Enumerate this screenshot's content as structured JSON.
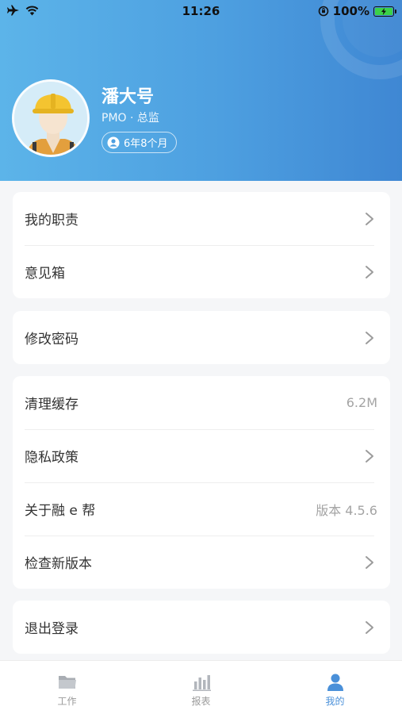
{
  "status_bar": {
    "time": "11:26",
    "battery_percent": "100%",
    "left_icons": [
      "airplane-icon",
      "wifi-icon"
    ],
    "right_icons": [
      "orientation-lock-icon",
      "battery-charging-icon"
    ]
  },
  "profile": {
    "name": "潘大号",
    "role": "PMO · 总监",
    "tenure": "6年8个月",
    "avatar": "worker-with-hard-hat"
  },
  "menu_groups": [
    [
      {
        "label": "我的职责",
        "value": "",
        "arrow": true
      },
      {
        "label": "意见箱",
        "value": "",
        "arrow": true
      }
    ],
    [
      {
        "label": "修改密码",
        "value": "",
        "arrow": true
      }
    ],
    [
      {
        "label": "清理缓存",
        "value": "6.2M",
        "arrow": false
      },
      {
        "label": "隐私政策",
        "value": "",
        "arrow": true
      },
      {
        "label": "关于融 e 帮",
        "value": "版本 4.5.6",
        "arrow": false
      },
      {
        "label": "检查新版本",
        "value": "",
        "arrow": true
      }
    ],
    [
      {
        "label": "退出登录",
        "value": "",
        "arrow": true
      }
    ]
  ],
  "tabs": [
    {
      "label": "工作",
      "icon": "folder-icon",
      "active": false
    },
    {
      "label": "报表",
      "icon": "bar-chart-icon",
      "active": false
    },
    {
      "label": "我的",
      "icon": "person-icon",
      "active": true
    }
  ],
  "colors": {
    "header_gradient_start": "#5cb4e9",
    "header_gradient_end": "#3f87d3",
    "accent": "#4a90d9",
    "inactive_tab": "#9a9a9a",
    "page_background": "#f5f6f8"
  }
}
